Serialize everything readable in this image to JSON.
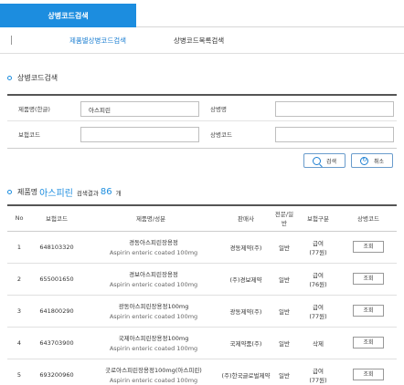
{
  "top_tabs": [
    {
      "label": "상병코드검색"
    }
  ],
  "sub_tabs": [
    {
      "label": "제품별상병코드검색"
    },
    {
      "label": "상병코드목록검색"
    }
  ],
  "search_section": {
    "title": "상병코드검색",
    "fields": {
      "product_name_label": "제품명(한글)",
      "product_name_value": "아스피린",
      "disease_name_label": "상병명",
      "insurance_code_label": "보험코드",
      "disease_code_label": "상병코드"
    },
    "search_button": "검색",
    "reset_button": "취소"
  },
  "result_header": {
    "prefix": "제품명",
    "keyword": "아스피린",
    "mid": "검색결과",
    "count": "86",
    "suffix": "개"
  },
  "table": {
    "headers": [
      "No",
      "보험코드",
      "제품명/성분",
      "판매사",
      "전문/일반",
      "보험구분",
      "상병코드"
    ],
    "rows": [
      {
        "no": "1",
        "code": "648103320",
        "name": "경동아스피린장용정",
        "ingredient": "Aspirin enteric coated 100mg",
        "company": "경동제약(주)",
        "type": "일반",
        "insurance": "급여\n(77원)",
        "action": "조회"
      },
      {
        "no": "2",
        "code": "655001650",
        "name": "경보아스피린장용정",
        "ingredient": "Aspirin enteric coated 100mg",
        "company": "(주)경보제약",
        "type": "일반",
        "insurance": "급여\n(76원)",
        "action": "조회"
      },
      {
        "no": "3",
        "code": "641800290",
        "name": "광동아스피린장용정100mg",
        "ingredient": "Aspirin enteric coated 100mg",
        "company": "광동제약(주)",
        "type": "일반",
        "insurance": "급여\n(77원)",
        "action": "조회"
      },
      {
        "no": "4",
        "code": "643703900",
        "name": "국제아스피린장용정100mg",
        "ingredient": "Aspirin enteric coated 100mg",
        "company": "국제약품(주)",
        "type": "일반",
        "insurance": "삭제",
        "action": "조회"
      },
      {
        "no": "5",
        "code": "693200960",
        "name": "굿로아스피린장용정100mg(아스피린)",
        "ingredient": "Aspirin enteric coated 100mg",
        "company": "(주)한국글로벌제약",
        "type": "일반",
        "insurance": "급여\n(77원)",
        "action": "조회"
      }
    ]
  },
  "colors": {
    "accent": "#1c8ddf",
    "active_tab_text": "#1c7fd2"
  }
}
